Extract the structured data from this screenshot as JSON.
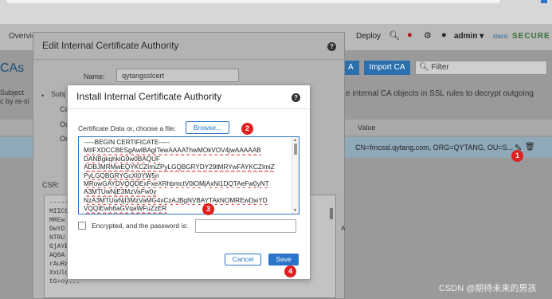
{
  "app": {
    "nav_overview": "Overvie",
    "deploy": "Deploy",
    "admin": "admin",
    "brand_cisco": "cisco",
    "brand_secure": "SECURE",
    "page_title": "CAs",
    "add_button": "A",
    "import_button": "Import CA",
    "filter_placeholder": "Filter",
    "intro_text": "e internal CA objects in SSL rules to decrypt outgoing",
    "left_text_1": "Subject",
    "left_text_2": "c by re-si",
    "column_value": "Value",
    "row_value": "CN=fmcssl.qytang.com, ORG=QYTANG, OU=S..."
  },
  "outer_dialog": {
    "title": "Edit Internal Certificate Authority",
    "name_label": "Name:",
    "name_value": "qytangsslcert",
    "stub_subj": "Subj",
    "stub_ca": "Ca",
    "stub_o1": "Or",
    "stub_o2": "Or",
    "csr_label": "CSR:",
    "csr_lines": [
      "-----",
      "MIIC9",
      "MREw",
      "DwYD",
      "NTRU",
      "GjAYE",
      "AQ8A",
      "rAuRa",
      "XxUlc",
      "tG+oy..."
    ],
    "csr_tail": "A"
  },
  "inner_dialog": {
    "title": "Install Internal Certificate Authority",
    "cert_label": "Certificate Data or, choose a file:",
    "browse_label": "Browse...",
    "cert_lines": [
      "-----BEGIN CERTIFICATE-----",
      "MIIFXDCCBESgAwIBAgITewAAAAThwMOkVOV4jwAAAAAB",
      "DANBgkqhkiG9w0BAQUF",
      "ADBJMRMwEQYKCZImiZPyLGQBGRYDY29tMRYwFAYKCZImiZ",
      "PyLGQBGRYGcXl0YW5n",
      "MRowGAYDVQQDExFxeXRhbmctV0lOMjAxNi1DQTAeFw0yNT",
      "A3MTUwNjE3MzVaFw0y",
      "NzA3MTUwNjI3MzVaMG4xCzAJBgNVBAYTAkNOMREwDwYD",
      "VQQIEwh6aGVqaWFuZzER"
    ],
    "encrypted_label": "Encrypted, and the password is:",
    "cancel_label": "Cancel",
    "save_label": "Save"
  },
  "markers": [
    "1",
    "2",
    "3",
    "4"
  ],
  "watermark": "CSDN @期待未来的男孩",
  "icons": [
    "search-icon",
    "alert-icon",
    "gear-icon",
    "help-icon",
    "edit-icon",
    "trash-icon",
    "filter-search-icon"
  ]
}
